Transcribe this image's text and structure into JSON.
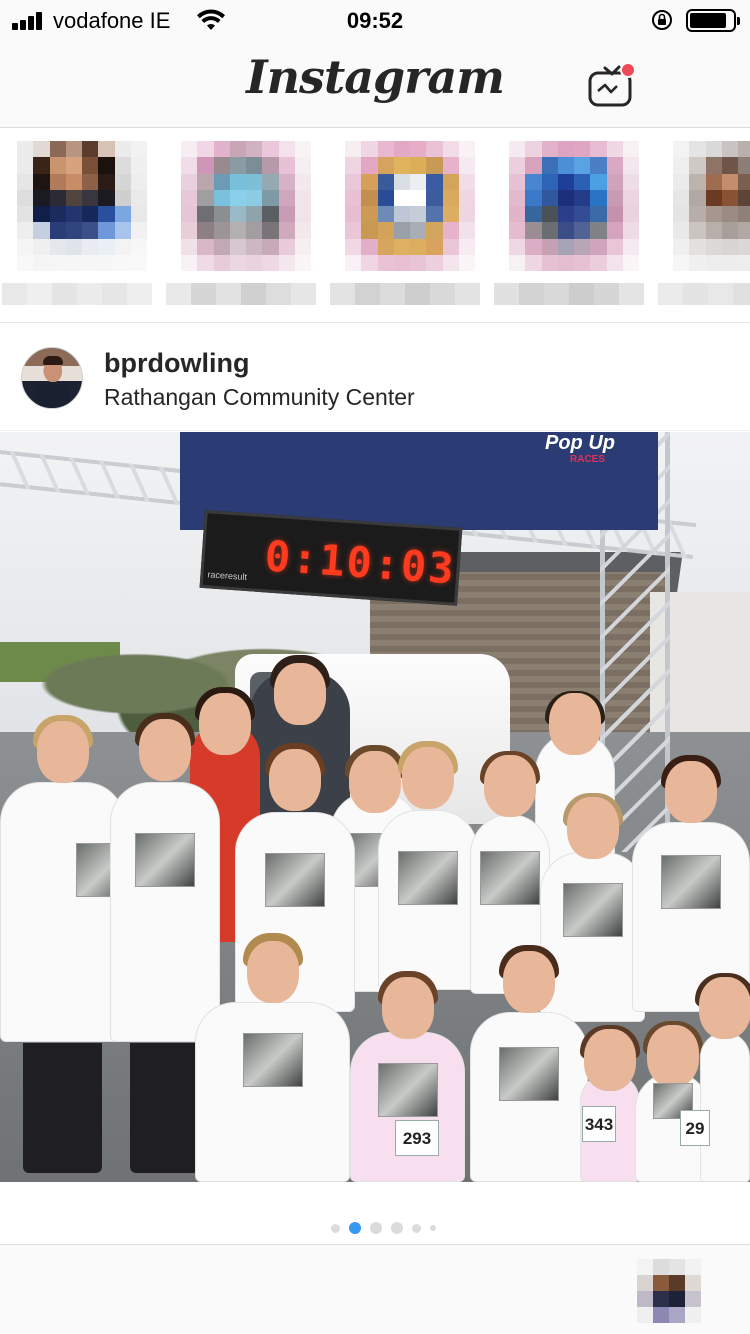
{
  "status_bar": {
    "carrier": "vodafone IE",
    "time": "09:52",
    "battery_level": 0.85
  },
  "header": {
    "logo_text": "Instagram",
    "igtv_icon": "igtv-icon",
    "notification_color": "#ed4956"
  },
  "stories": {
    "items": [
      {
        "avatar_palette": [
          "#ececec",
          "#e2d9d4",
          "#8a6a56",
          "#b89580",
          "#5b3b2c",
          "#d8c2b5",
          "#ececec",
          "#f2f2f2",
          "#ececec",
          "#3a2418",
          "#c9946e",
          "#d9a27f",
          "#7a4f38",
          "#1c120d",
          "#dcdcdc",
          "#f0f0f0",
          "#e6e6e6",
          "#1e1510",
          "#b17a5a",
          "#c88c67",
          "#8e6047",
          "#2a1c14",
          "#d6d6d6",
          "#eeeeee",
          "#dddddd",
          "#1a1a22",
          "#2c2a35",
          "#51443c",
          "#3a3640",
          "#1d1b22",
          "#cfcfcf",
          "#eaeaea",
          "#e3e3e3",
          "#0f1f4a",
          "#1b2b5e",
          "#23356e",
          "#16285a",
          "#2a4f9e",
          "#7aa7e0",
          "#e8e8e8",
          "#eeeeee",
          "#c6cfe0",
          "#2b3d78",
          "#31457d",
          "#3b4f88",
          "#6f98da",
          "#a8c3ec",
          "#f1f1f1",
          "#f5f5f5",
          "#f0f0f0",
          "#e6e6ee",
          "#dfe3ea",
          "#e9ecf2",
          "#eaeef5",
          "#f3f3f3",
          "#f7f7f7",
          "#f8f8f8",
          "#f5f5f5",
          "#f6f6f6",
          "#f7f7f7",
          "#f6f6f6",
          "#f7f7f7",
          "#f8f8f8",
          "#f9f9f9"
        ],
        "name_palette": [
          "#e8e8e8",
          "#efefef",
          "#e5e5e5",
          "#ececec",
          "#e6e6e6",
          "#eeeeee"
        ]
      },
      {
        "avatar_palette": [
          "#f6eef2",
          "#f1d7e6",
          "#e2b3cc",
          "#c8a6b5",
          "#d0b2c2",
          "#ebc7db",
          "#f3e1eb",
          "#f8f4f6",
          "#f0dde8",
          "#cf96b8",
          "#9a8a90",
          "#8a9ba4",
          "#7c8d98",
          "#b79aa9",
          "#e8c1d7",
          "#f5eef2",
          "#ead0df",
          "#b9a7ad",
          "#6d9bb6",
          "#79c0dd",
          "#7dbed9",
          "#94a9b2",
          "#d6b2c6",
          "#f3e8ee",
          "#e6c8d8",
          "#9f9fa2",
          "#7ac1de",
          "#8ad0ea",
          "#8bcbe4",
          "#7e9aa6",
          "#cfa6bd",
          "#f1e5eb",
          "#e5c5d6",
          "#6f6f73",
          "#8c8f92",
          "#9ab9c7",
          "#8fa3ad",
          "#5b5e63",
          "#c79cb4",
          "#f0e3ea",
          "#e9cdd9",
          "#8e7f85",
          "#9c9497",
          "#b4b0b2",
          "#a29da0",
          "#7a7478",
          "#d0a9bd",
          "#f2e8ed",
          "#f1e0e8",
          "#d8b7c6",
          "#c2a8b4",
          "#d7c8cf",
          "#cdb8c2",
          "#c7a9b8",
          "#e9ccdb",
          "#f6eef2",
          "#f8f1f5",
          "#efdbe5",
          "#e8cbd9",
          "#ecd6e1",
          "#ead3df",
          "#edd8e3",
          "#f4e7ee",
          "#faf6f8"
        ],
        "name_palette": [
          "#e9e9e9",
          "#d6d6d6",
          "#e2e2e2",
          "#d0d0d0",
          "#dddddd",
          "#e6e6e6"
        ]
      },
      {
        "avatar_palette": [
          "#f7eef3",
          "#f0d6e4",
          "#e7b8cf",
          "#e3a8c6",
          "#e6adc9",
          "#ebc1d6",
          "#f2dce7",
          "#f8f2f5",
          "#efd5e2",
          "#e4a7c3",
          "#d6a35e",
          "#e0b45f",
          "#dcae58",
          "#c99a55",
          "#e6b2cc",
          "#f5eaf0",
          "#ebc8d9",
          "#d7a05a",
          "#3a5a9a",
          "#d9dde4",
          "#eceef2",
          "#3a5aa1",
          "#d4a45c",
          "#f0dde7",
          "#e9c0d4",
          "#c28f4e",
          "#284c96",
          "#ffffff",
          "#ffffff",
          "#3d5c9d",
          "#d9a95d",
          "#eed7e3",
          "#e7bdd1",
          "#cc9a55",
          "#6e8bb8",
          "#bfc7d6",
          "#c6ccd8",
          "#5473ad",
          "#dcae62",
          "#edd5e1",
          "#eac6d7",
          "#c99851",
          "#d3a35b",
          "#9aa0a8",
          "#a9aeb6",
          "#d2a55d",
          "#e6b2cc",
          "#f1e1e9",
          "#f0d9e5",
          "#e3aec8",
          "#d8a55f",
          "#dfb062",
          "#deae60",
          "#d9a35e",
          "#ebc5d8",
          "#f6ecf1",
          "#f8f0f4",
          "#efd6e2",
          "#e9c2d5",
          "#e8bfd3",
          "#e9c4d6",
          "#edd0de",
          "#f4e4ec",
          "#faf6f8"
        ],
        "name_palette": [
          "#e3e3e3",
          "#d2d2d2",
          "#dcdcdc",
          "#cecece",
          "#d9d9d9",
          "#e3e3e3"
        ]
      },
      {
        "avatar_palette": [
          "#f4eaf0",
          "#edd2e0",
          "#e2b1ca",
          "#dea3c2",
          "#dfa6c4",
          "#e7bcd2",
          "#f0d8e4",
          "#f7f1f4",
          "#ecd0de",
          "#d8a2bd",
          "#3b6fb8",
          "#4d8fd6",
          "#5aa2e2",
          "#4a7fc5",
          "#d9a9c3",
          "#f3e6ed",
          "#e7c2d5",
          "#4a86cf",
          "#2e64b6",
          "#1d3f96",
          "#2c5fb5",
          "#4aa0e3",
          "#cfa3bc",
          "#efdde6",
          "#e3b9cd",
          "#3a78c8",
          "#31589e",
          "#1c2f7a",
          "#243c8a",
          "#2a74c6",
          "#c89bb4",
          "#ecd5e1",
          "#e1b4c9",
          "#35679e",
          "#4b5257",
          "#2b3e8a",
          "#334c94",
          "#3a6aa8",
          "#c592ad",
          "#ebd2df",
          "#e4bbd0",
          "#9a8e93",
          "#6a6e72",
          "#3b4d86",
          "#516394",
          "#7f8387",
          "#d4a3bd",
          "#eedbe4",
          "#efd8e3",
          "#dcaec6",
          "#c6a0b3",
          "#a7a3b7",
          "#b8a5b6",
          "#d0a5bc",
          "#e8c6d7",
          "#f5eaf0",
          "#f8f1f4",
          "#eed6e2",
          "#e6c1d4",
          "#e5bdd1",
          "#e6c1d4",
          "#ebcddc",
          "#f3e3eb",
          "#faf6f8"
        ],
        "name_palette": [
          "#e1e1e1",
          "#d3d3d3",
          "#dadada",
          "#cdcdcd",
          "#d6d6d6",
          "#e4e4e4"
        ]
      },
      {
        "avatar_palette": [
          "#f3f3f3",
          "#e4e4e4",
          "#d9d9d9",
          "#c9c4c2",
          "#b7b0ad",
          "#c8c2bf",
          "#dedede",
          "#f2f2f2",
          "#efefef",
          "#cfc8c4",
          "#8d7466",
          "#6e5548",
          "#8c7d77",
          "#b9aeaa",
          "#d9d9d9",
          "#f0f0f0",
          "#ebebeb",
          "#bdb3ad",
          "#a06c50",
          "#c48d6c",
          "#7a5e50",
          "#a9a09c",
          "#d2d2d2",
          "#eeeeee",
          "#e6e6e6",
          "#b2a8a3",
          "#6a3a22",
          "#8a5234",
          "#5c4438",
          "#a29894",
          "#cfcfcf",
          "#ececec",
          "#e4e4e4",
          "#b7aeaa",
          "#a79690",
          "#9b8b84",
          "#8f807a",
          "#aaa19e",
          "#d1d1d1",
          "#ededed",
          "#e9e9e9",
          "#cbc5c2",
          "#b8aeaa",
          "#a89f9b",
          "#b1a8a4",
          "#c6c0bd",
          "#dcdcdc",
          "#f0f0f0",
          "#f0f0f0",
          "#e3e1e0",
          "#dcd9d8",
          "#d8d5d4",
          "#dad7d6",
          "#e1dfde",
          "#e9e9e9",
          "#f4f4f4",
          "#f6f6f6",
          "#f0f0f0",
          "#eeeeee",
          "#ededed",
          "#eeeeee",
          "#f0f0f0",
          "#f4f4f4",
          "#f8f8f8"
        ],
        "name_palette": [
          "#ebebeb",
          "#e3e3e3",
          "#e8e8e8",
          "#e0e0e0",
          "#e6e6e6",
          "#ededed"
        ]
      }
    ]
  },
  "post": {
    "username": "bprdowling",
    "location": "Rathangan Community Center",
    "photo": {
      "banner_text": "Pop Up",
      "banner_subtext": "RACES",
      "timer_text": "0:10:03",
      "timer_brand": "raceresult",
      "bib_numbers": [
        "293",
        "343",
        "29"
      ]
    },
    "carousel": {
      "count": 6,
      "active_index": 1,
      "active_color": "#3897f0",
      "inactive_color": "#dbdbdb"
    }
  },
  "tab_bar": {
    "profile_palette": [
      "#f3f3f3",
      "#dcdcdc",
      "#e4e4e4",
      "#f2f2f2",
      "#d9d4d0",
      "#8a5a3c",
      "#5a3a28",
      "#e0d8d2",
      "#bfb8c8",
      "#2b2f4a",
      "#1d2238",
      "#c6c2ce",
      "#efefef",
      "#8c88b4",
      "#a8a5c5",
      "#f0f0f0"
    ]
  }
}
